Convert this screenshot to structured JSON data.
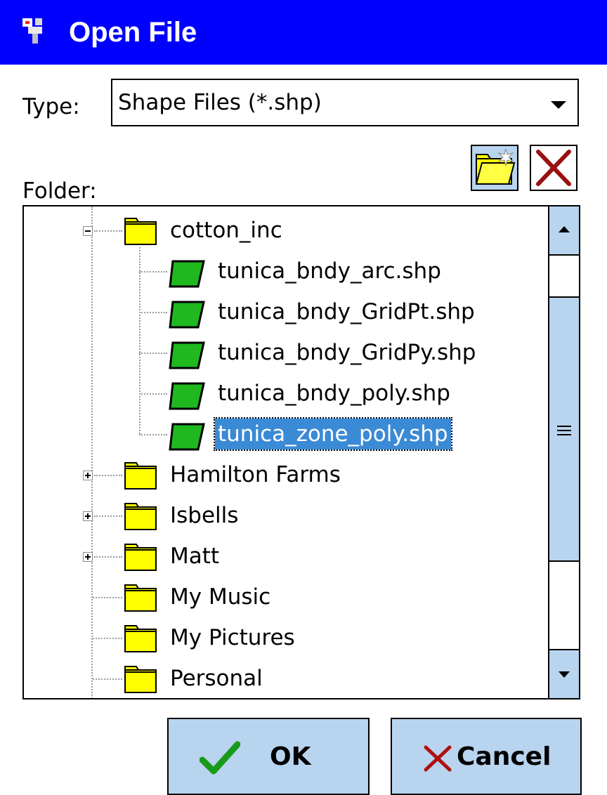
{
  "window": {
    "title": "Open File",
    "icon": "pda-app-icon"
  },
  "type_field": {
    "label": "Type:",
    "value": "Shape Files (*.shp)"
  },
  "folder": {
    "label": "Folder:",
    "toolbar": {
      "new_folder_icon": "new-folder-icon",
      "delete_icon": "delete-x-icon"
    }
  },
  "tree": {
    "items": [
      {
        "label": "cotton_inc",
        "kind": "folder",
        "expander": "minus"
      },
      {
        "label": "tunica_bndy_arc.shp",
        "kind": "shapefile"
      },
      {
        "label": "tunica_bndy_GridPt.shp",
        "kind": "shapefile"
      },
      {
        "label": "tunica_bndy_GridPy.shp",
        "kind": "shapefile"
      },
      {
        "label": "tunica_bndy_poly.shp",
        "kind": "shapefile"
      },
      {
        "label": "tunica_zone_poly.shp",
        "kind": "shapefile",
        "selected": true
      },
      {
        "label": "Hamilton Farms",
        "kind": "folder",
        "expander": "plus"
      },
      {
        "label": "Isbells",
        "kind": "folder",
        "expander": "plus"
      },
      {
        "label": "Matt",
        "kind": "folder",
        "expander": "plus"
      },
      {
        "label": "My Music",
        "kind": "folder"
      },
      {
        "label": "My Pictures",
        "kind": "folder"
      },
      {
        "label": "Personal",
        "kind": "folder"
      }
    ]
  },
  "buttons": {
    "ok": "OK",
    "cancel": "Cancel"
  },
  "colors": {
    "titlebar": "#0000ff",
    "selection": "#3a8ad6",
    "button_face": "#b8d4ef",
    "folder_yellow": "#ffff00",
    "shapefile_green": "#1fb81f"
  }
}
